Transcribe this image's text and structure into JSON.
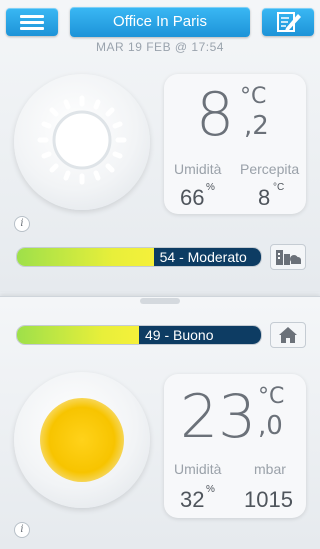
{
  "header": {
    "title": "Office In Paris",
    "datetime": "MAR 19 FEB @ 17:54"
  },
  "outdoor": {
    "temp_int": "8",
    "temp_dec": ",2",
    "unit": "°C",
    "humidity_label": "Umidità",
    "humidity_value": "66",
    "humidity_unit": "%",
    "perceived_label": "Percepita",
    "perceived_value": "8",
    "perceived_unit": "°C",
    "condition_icon": "sun-outline-icon",
    "info_glyph": "i"
  },
  "outdoor_air": {
    "value": 54,
    "label": "54 - Moderato",
    "fill_fraction": 0.56
  },
  "indoor_air": {
    "value": 49,
    "label": "49 - Buono",
    "fill_fraction": 0.5
  },
  "indoor": {
    "temp_int": "23",
    "temp_dec": ",0",
    "unit": "°C",
    "humidity_label": "Umidità",
    "humidity_value": "32",
    "humidity_unit": "%",
    "pressure_label": "mbar",
    "pressure_value": "1015",
    "info_glyph": "i"
  },
  "colors": {
    "accent": "#2aa8ec",
    "bar_label_bg": "#0d3c63",
    "sun": "#f5c400"
  }
}
